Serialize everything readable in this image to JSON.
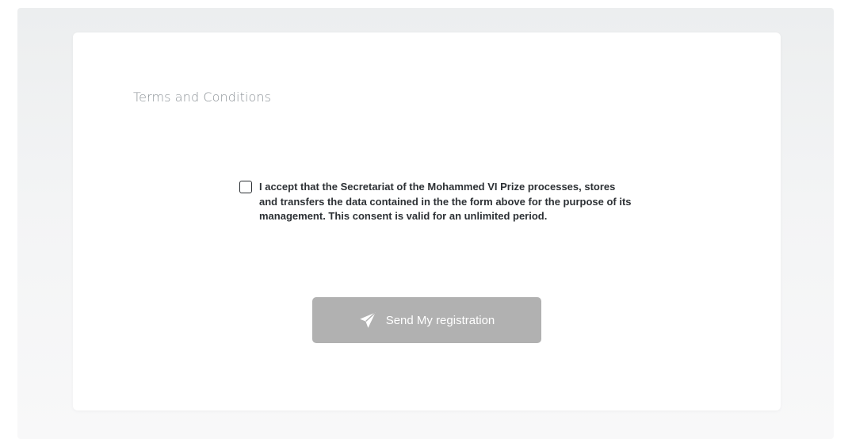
{
  "form": {
    "section_title": "Terms and Conditions",
    "consent_text": "I accept that the Secretariat of the Mohammed VI Prize processes, stores and transfers the data contained in the the form above for the purpose of its management. This consent is valid for an unlimited period.",
    "consent_checked": false,
    "submit_label": "Send My registration",
    "submit_icon": "paper-plane-icon"
  },
  "colors": {
    "button_background": "#b1b1b1",
    "button_text": "#ffffff",
    "title_text": "#8d9398",
    "body_text": "#2d3135"
  }
}
